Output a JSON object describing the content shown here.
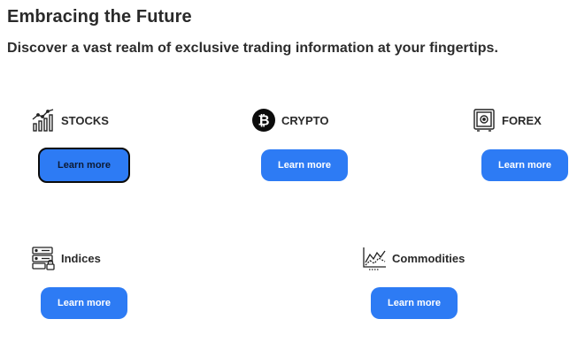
{
  "header": {
    "title": "Embracing the Future",
    "subtitle": "Discover a vast realm of exclusive trading information at your fingertips."
  },
  "cards": [
    {
      "id": "stocks",
      "label": "STOCKS",
      "icon": "stock-chart-icon",
      "button_label": "Learn more",
      "focused": true
    },
    {
      "id": "crypto",
      "label": "CRYPTO",
      "icon": "bitcoin-icon",
      "button_label": "Learn more",
      "focused": false
    },
    {
      "id": "forex",
      "label": "FOREX",
      "icon": "safe-icon",
      "button_label": "Learn more",
      "focused": false
    },
    {
      "id": "indices",
      "label": "Indices",
      "icon": "server-lock-icon",
      "button_label": "Learn more",
      "focused": false
    },
    {
      "id": "commodities",
      "label": "Commodities",
      "icon": "line-chart-icon",
      "button_label": "Learn more",
      "focused": false
    }
  ],
  "colors": {
    "accent": "#2d7bf4",
    "text": "#2a2a2a",
    "focus_border": "#0b0b0b"
  }
}
